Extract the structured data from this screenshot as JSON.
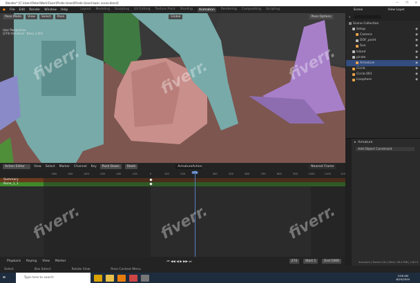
{
  "title": "Blender* [C:\\Users\\Peter\\Work\\Fiverr\\Pirate Island\\Pirate Island basic scene.blend]",
  "window_controls": [
    "—",
    "❐",
    "✕"
  ],
  "menu": [
    "File",
    "Edit",
    "Render",
    "Window",
    "Help"
  ],
  "workspaces": [
    "Layout",
    "Modeling",
    "Sculpting",
    "UV Editing",
    "Texture Paint",
    "Shading",
    "Animation",
    "Rendering",
    "Compositing",
    "Scripting"
  ],
  "active_workspace": "Animation",
  "scene": "Scene",
  "view_layer": "View Layer",
  "viewport": {
    "mode": "Pose Mode",
    "menus": [
      "View",
      "Select",
      "Pose"
    ],
    "orientation": "Global",
    "pose_options": "Pose Options",
    "overlay_text": [
      "User Perspective",
      "(274) Armature : Bone_1.001"
    ]
  },
  "outliner": {
    "root": "Scene Collection",
    "items": [
      {
        "label": "Setup",
        "color": "#bbbbbb",
        "indent": 1
      },
      {
        "label": "Camera",
        "color": "#e8a24a",
        "indent": 2
      },
      {
        "label": "DOF_point",
        "color": "#bbbbbb",
        "indent": 2
      },
      {
        "label": "Sun",
        "color": "#e8a24a",
        "indent": 2
      },
      {
        "label": "Island",
        "color": "#bbbbbb",
        "indent": 1
      },
      {
        "label": "pirate",
        "color": "#bbbbbb",
        "indent": 1
      },
      {
        "label": "Armature",
        "color": "#e8a24a",
        "indent": 2,
        "selected": true
      },
      {
        "label": "Circle",
        "color": "#e8a24a",
        "indent": 1
      },
      {
        "label": "Circle.001",
        "color": "#e8a24a",
        "indent": 1
      },
      {
        "label": "Icosphere",
        "color": "#e8a24a",
        "indent": 1
      }
    ]
  },
  "properties": {
    "object": "Armature",
    "constraint": "Add Object Constraint"
  },
  "dopesheet": {
    "editor": "Action Editor",
    "menus": [
      "View",
      "Select",
      "Marker",
      "Channel",
      "Key"
    ],
    "push_down": "Push Down",
    "stash": "Stash",
    "action": "ArmatureAction",
    "snap": "Nearest Frame",
    "channels": [
      {
        "label": "Summary",
        "color": "#6a3a1c"
      },
      {
        "label": "Bone_1_1",
        "color": "#3f8a2a"
      }
    ],
    "ticks": [
      -600,
      -500,
      -400,
      -300,
      -200,
      -100,
      0,
      100,
      200,
      400,
      500,
      600,
      700,
      800,
      900,
      1000,
      1100,
      1200
    ],
    "current_frame": 274
  },
  "timeline": {
    "menus": [
      "Playback",
      "Keying",
      "View",
      "Marker"
    ],
    "frame": "274",
    "start_label": "Start",
    "start": "1",
    "end_label": "End",
    "end": "1000"
  },
  "status": {
    "items": [
      "Select",
      "Box Select",
      "Rotate View",
      "Pose Context Menu"
    ],
    "stats": "Armature | Bones:1/40 | Mem: 38.0 MiB | 2.83.4"
  },
  "taskbar": {
    "search_placeholder": "Type here to search",
    "time": "3:56 AM",
    "date": "8/25/2020"
  },
  "watermark": "fiverr."
}
